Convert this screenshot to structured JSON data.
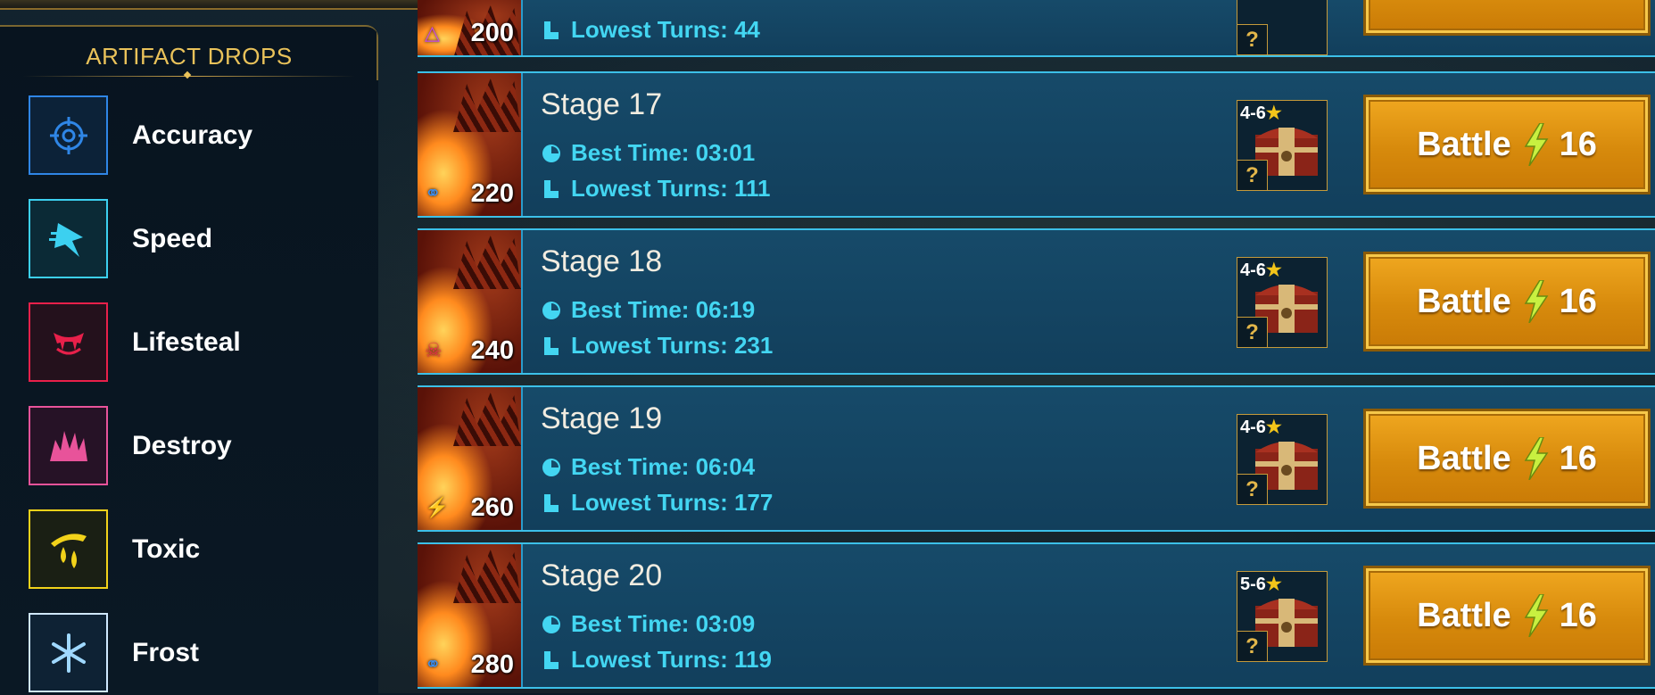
{
  "sidebar": {
    "title": "ARTIFACT DROPS",
    "items": [
      {
        "label": "Accuracy",
        "icon": "accuracy-icon",
        "color": "#2f86e6"
      },
      {
        "label": "Speed",
        "icon": "speed-icon",
        "color": "#3cd0f0"
      },
      {
        "label": "Lifesteal",
        "icon": "lifesteal-icon",
        "color": "#e8204a"
      },
      {
        "label": "Destroy",
        "icon": "destroy-icon",
        "color": "#e8539a"
      },
      {
        "label": "Toxic",
        "icon": "toxic-icon",
        "color": "#f2d21a"
      },
      {
        "label": "Frost",
        "icon": "frost-icon",
        "color": "#9fd8ff"
      }
    ]
  },
  "partial_row": {
    "power": "200",
    "turns_label": "Lowest Turns: 44",
    "affinity": "void"
  },
  "stages": [
    {
      "name": "Stage 17",
      "best_time": "Best Time: 03:01",
      "lowest_turns": "Lowest Turns: 111",
      "power": "220",
      "affinity": "magic",
      "stars": "4-6",
      "battle_label": "Battle",
      "energy": "16"
    },
    {
      "name": "Stage 18",
      "best_time": "Best Time: 06:19",
      "lowest_turns": "Lowest Turns: 231",
      "power": "240",
      "affinity": "force",
      "stars": "4-6",
      "battle_label": "Battle",
      "energy": "16"
    },
    {
      "name": "Stage 19",
      "best_time": "Best Time: 06:04",
      "lowest_turns": "Lowest Turns: 177",
      "power": "260",
      "affinity": "spirit",
      "stars": "4-6",
      "battle_label": "Battle",
      "energy": "16"
    },
    {
      "name": "Stage 20",
      "best_time": "Best Time: 03:09",
      "lowest_turns": "Lowest Turns: 119",
      "power": "280",
      "affinity": "magic",
      "stars": "5-6",
      "battle_label": "Battle",
      "energy": "16"
    }
  ],
  "colors": {
    "accent_gold": "#e9c25a",
    "stat_cyan": "#43d6f2",
    "row_border": "#3cc0e8",
    "battle_orange": "#e09a14"
  }
}
